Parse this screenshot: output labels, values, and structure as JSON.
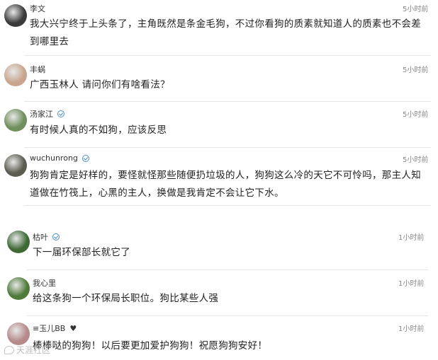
{
  "comments": [
    {
      "name": "李文",
      "verified": false,
      "heart": false,
      "time": "5小时前",
      "text": "我大兴宁终于上头条了，主角既然是条金毛狗，不过你看狗的质素就知道人的质素也不会差到哪里去",
      "avatar_color": "#3a3a3a"
    },
    {
      "name": "丰蜗",
      "verified": false,
      "heart": false,
      "time": "5小时前",
      "text": "广西玉林人 请问你们有啥看法？",
      "avatar_color": "#c9a58f"
    },
    {
      "name": "汤家江",
      "verified": true,
      "heart": false,
      "time": "5小时前",
      "text": "有时候人真的不如狗，应该反思",
      "avatar_color": "#6f8f5c"
    },
    {
      "name": "wuchunrong",
      "verified": true,
      "heart": false,
      "time": "5小时前",
      "text": "狗狗肯定是好样的，要怪就怪那些随便扔垃圾的人，狗狗这么冷的天它不可怜吗，那主人知道做在竹筏上，心黑的主人，换做是我肯定不会让它下水。",
      "avatar_color": "#5b5b4f"
    },
    {
      "name": "枯叶",
      "verified": true,
      "heart": false,
      "time": "1小时前",
      "text": "下一届环保部长就它了",
      "avatar_color": "#3f6a36"
    },
    {
      "name": "我心里",
      "verified": false,
      "heart": false,
      "time": "1小时前",
      "text": "给这条狗一个环保局长职位。狗比某些人强",
      "avatar_color": "#4f7a3a"
    },
    {
      "name": "≡玉儿BB",
      "verified": false,
      "heart": true,
      "time": "1小时前",
      "text": "棒棒哒的狗狗！以后要更加爱护狗狗！祝愿狗狗安好！",
      "avatar_color": "#b48a8a"
    }
  ],
  "watermark": "天涯社区",
  "icons": {
    "verified": "verified-badge-icon",
    "heart": "heart-icon"
  }
}
